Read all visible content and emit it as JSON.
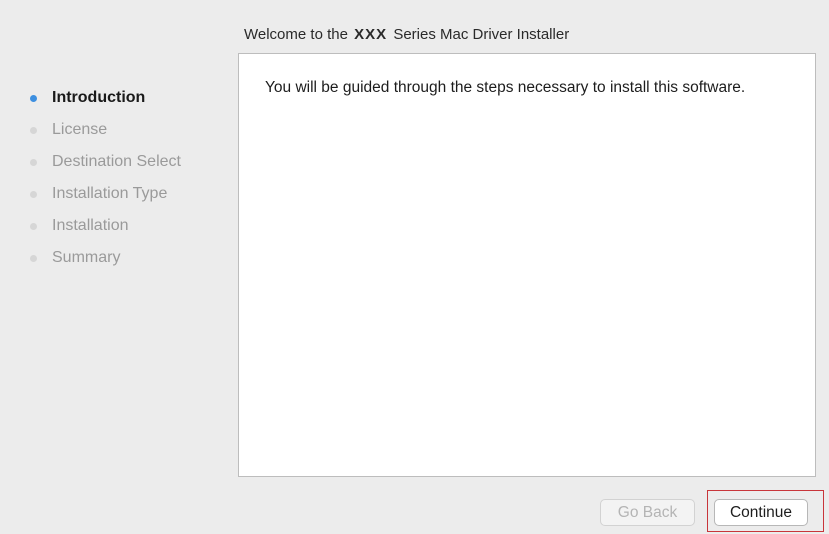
{
  "header": {
    "title_prefix": "Welcome to the",
    "title_product": "XXX",
    "title_suffix": "Series Mac Driver Installer"
  },
  "steps": [
    {
      "label": "Introduction",
      "active": true
    },
    {
      "label": "License",
      "active": false
    },
    {
      "label": "Destination Select",
      "active": false
    },
    {
      "label": "Installation Type",
      "active": false
    },
    {
      "label": "Installation",
      "active": false
    },
    {
      "label": "Summary",
      "active": false
    }
  ],
  "content": {
    "text": "You will be guided through the steps necessary to install this software."
  },
  "buttons": {
    "go_back": {
      "label": "Go Back",
      "enabled": false
    },
    "continue": {
      "label": "Continue",
      "enabled": true,
      "highlighted": true
    }
  },
  "colors": {
    "active_step_dot": "#3d8fe0",
    "inactive_step_dot": "#d6d6d6",
    "highlight_outline": "#c8353a",
    "window_background": "#ececec"
  }
}
